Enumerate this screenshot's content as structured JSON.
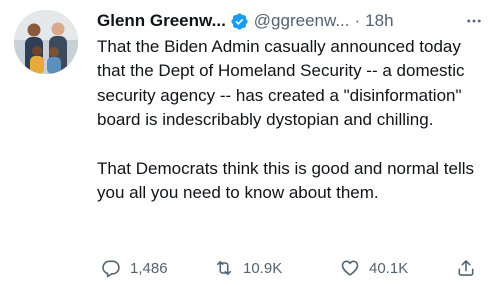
{
  "author": {
    "display_name": "Glenn Greenw...",
    "handle": "@ggreenw...",
    "separator": "·",
    "timestamp": "18h",
    "verified_color": "#1d9bf0"
  },
  "tweet": {
    "paragraphs": [
      "That the Biden Admin casually announced today that the Dept of Homeland Security -- a domestic security agency -- has created a \"disinformation\" board is indescribably dystopian and chilling.",
      "That Democrats think this is good and normal tells you all you need to know about them."
    ]
  },
  "actions": {
    "reply_count": "1,486",
    "retweet_count": "10.9K",
    "like_count": "40.1K"
  },
  "icons": {
    "more": "more-horizontal-icon",
    "reply": "reply-bubble-icon",
    "retweet": "retweet-arrows-icon",
    "like": "heart-icon",
    "share": "share-upload-icon",
    "verified": "verified-badge-icon"
  },
  "colors": {
    "text_primary": "#0f1419",
    "text_secondary": "#536471",
    "accent": "#1d9bf0"
  }
}
